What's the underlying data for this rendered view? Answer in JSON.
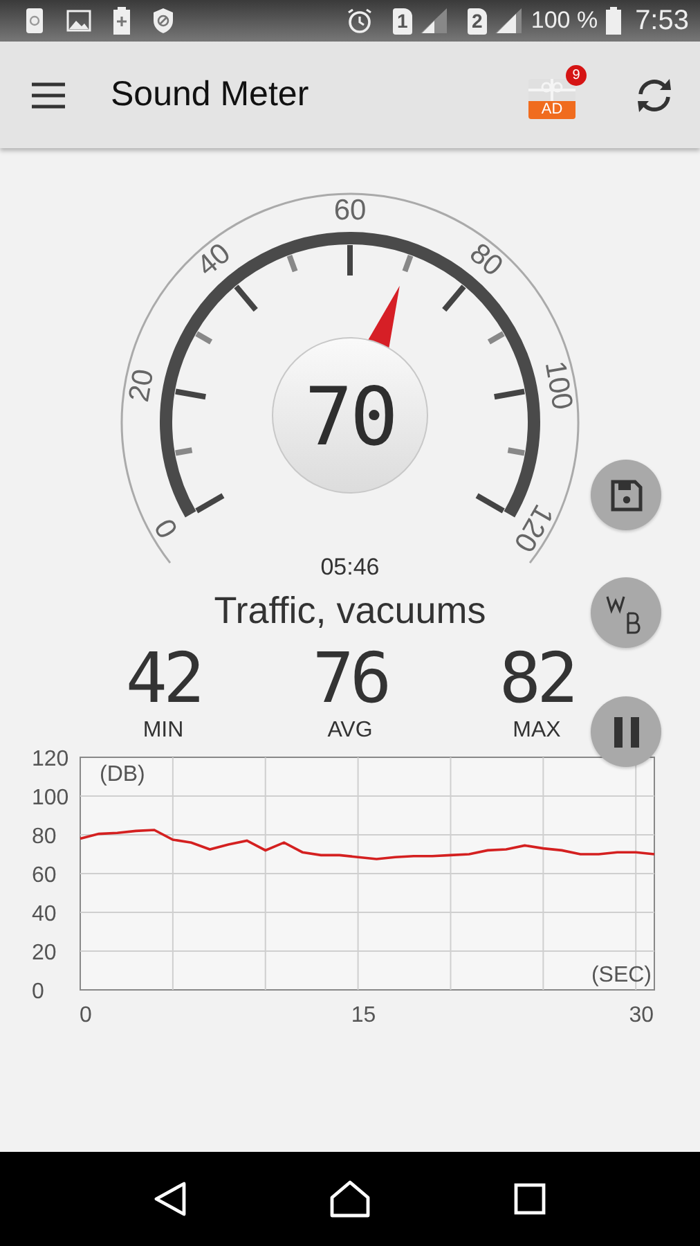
{
  "status_bar": {
    "sim_1": "1",
    "sim_2": "2",
    "battery": "100 %",
    "time": "7:53"
  },
  "app_bar": {
    "title": "Sound Meter",
    "ad_badge": "9",
    "ad_label": "AD"
  },
  "gauge": {
    "scale_labels": [
      "0",
      "20",
      "40",
      "60",
      "80",
      "100",
      "120"
    ],
    "reading": "70"
  },
  "elapsed": "05:46",
  "description": "Traffic, vacuums",
  "stats": [
    {
      "value": "42",
      "label": "MIN"
    },
    {
      "value": "76",
      "label": "AVG"
    },
    {
      "value": "82",
      "label": "MAX"
    }
  ],
  "chart_data": {
    "type": "line",
    "xlabel": "(SEC)",
    "ylabel": "(DB)",
    "xlim": [
      0,
      31
    ],
    "ylim": [
      0,
      120
    ],
    "xticks": [
      0,
      15,
      30
    ],
    "yticks": [
      0,
      20,
      40,
      60,
      80,
      100,
      120
    ],
    "grid": true,
    "x": [
      0,
      1,
      2,
      3,
      4,
      5,
      6,
      7,
      8,
      9,
      10,
      11,
      12,
      13,
      14,
      15,
      16,
      17,
      18,
      19,
      20,
      21,
      22,
      23,
      24,
      25,
      26,
      27,
      28,
      29,
      30,
      31
    ],
    "series": [
      {
        "color": "#d42020",
        "values": [
          78,
          80.5,
          81,
          82,
          82.5,
          77.5,
          76,
          72.5,
          75,
          77,
          72,
          76,
          71,
          69.5,
          69.5,
          68.5,
          67.5,
          68.5,
          69,
          69,
          69.5,
          70,
          72,
          72.5,
          74.5,
          73,
          72,
          70,
          70,
          71,
          71,
          70
        ]
      }
    ]
  }
}
